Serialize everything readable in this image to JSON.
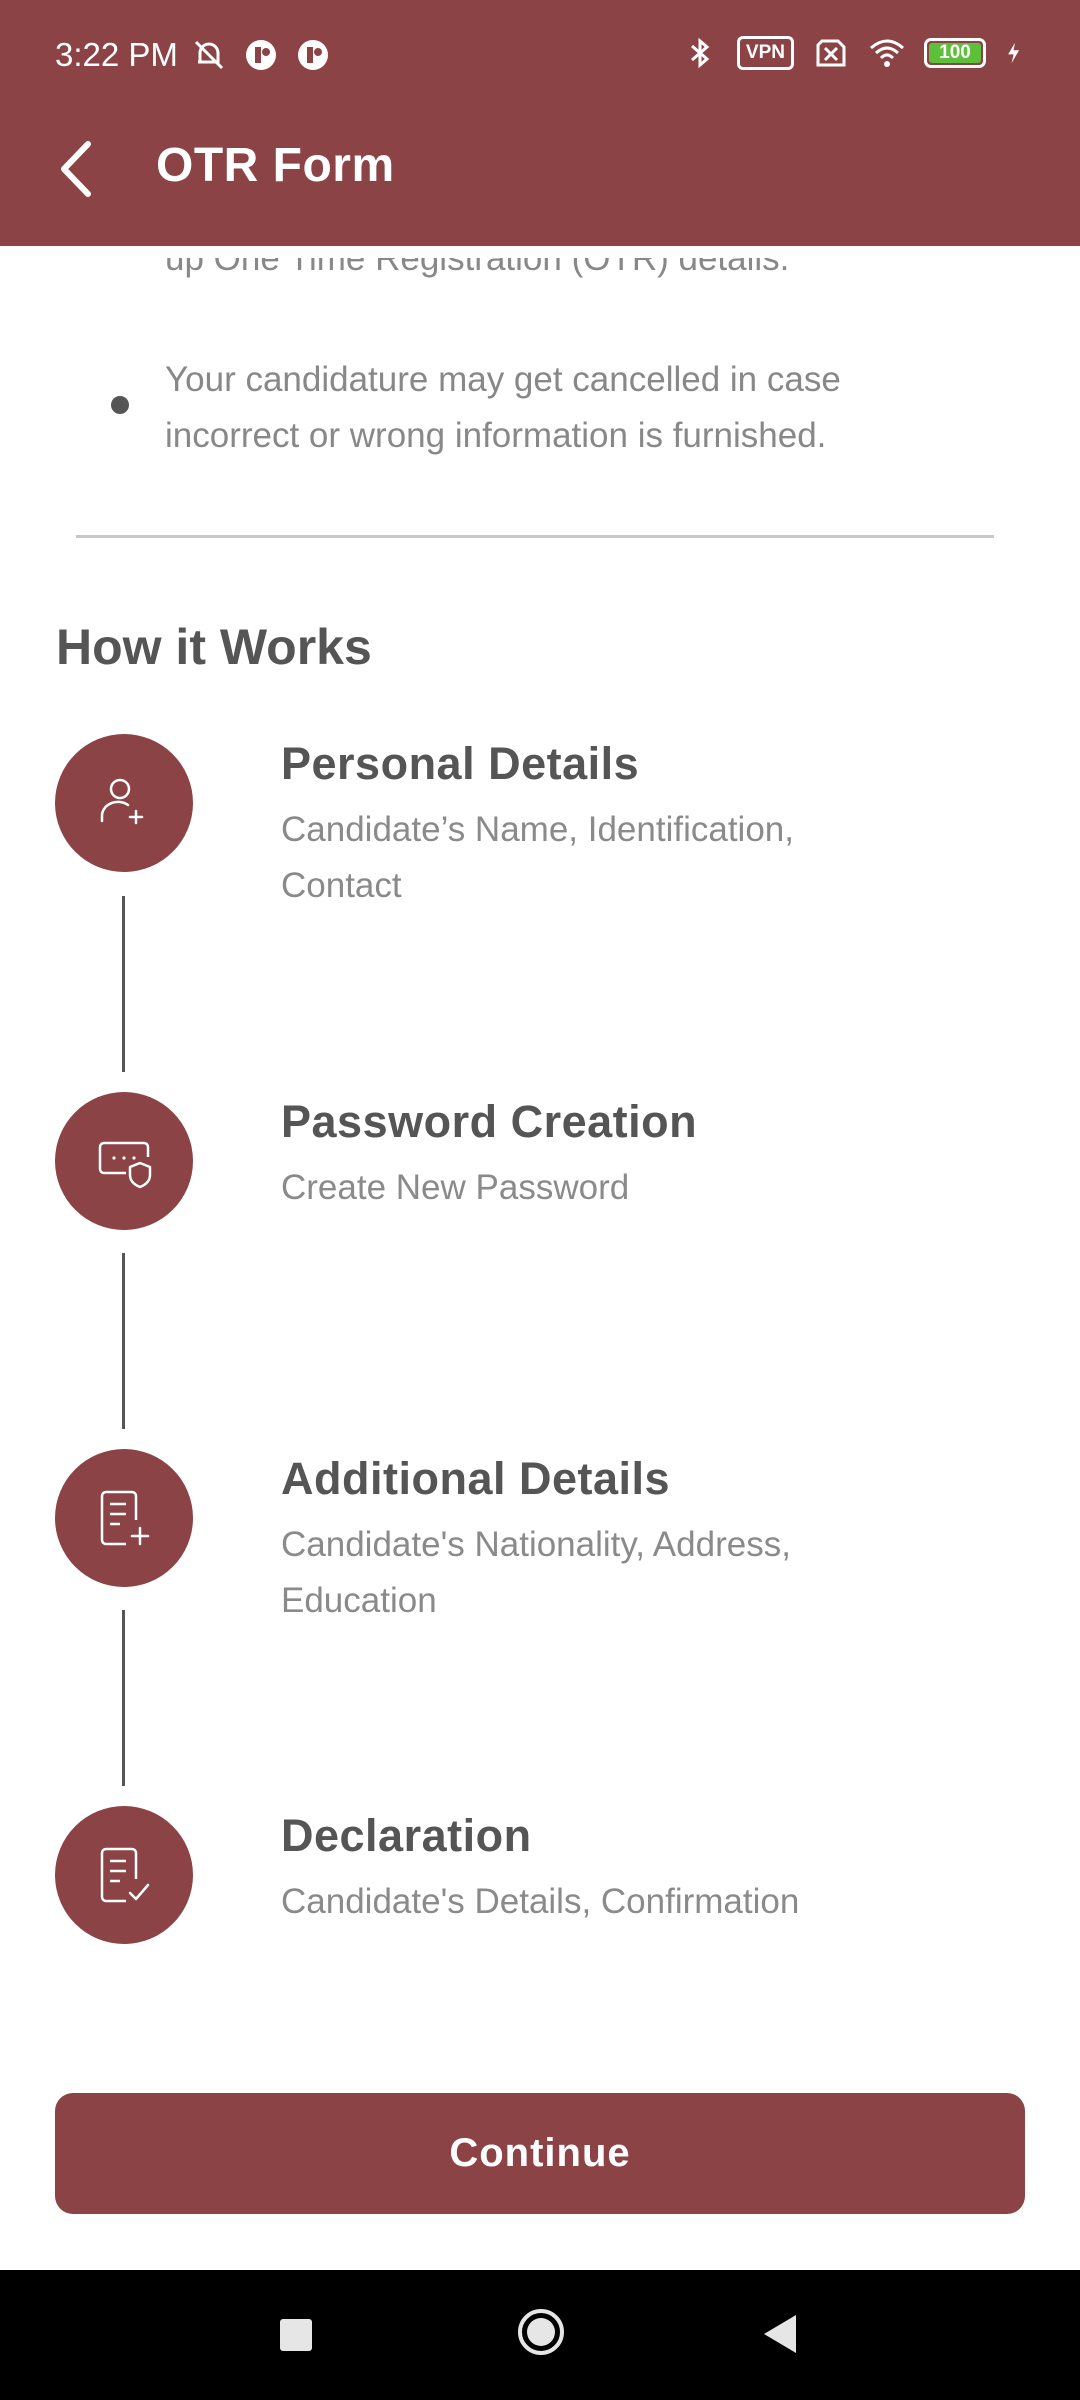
{
  "status_bar": {
    "time": "3:22 PM",
    "vpn": "VPN",
    "battery": "100"
  },
  "app_bar": {
    "title": "OTR Form"
  },
  "notes": {
    "cut_off_line": "up One Time Registration (OTR) details.",
    "bullet": "Your candidature may get cancelled in case incorrect or wrong information is furnished."
  },
  "how_it_works": {
    "title": "How it Works",
    "steps": [
      {
        "title": "Personal Details",
        "desc": "Candidate’s Name, Identification, Contact",
        "icon": "add-user-icon"
      },
      {
        "title": "Password Creation",
        "desc": "Create New Password",
        "icon": "password-shield-icon"
      },
      {
        "title": "Additional Details",
        "desc": "Candidate's Nationality, Address, Education",
        "icon": "document-add-icon"
      },
      {
        "title": "Declaration",
        "desc": "Candidate's Details, Confirmation",
        "icon": "document-check-icon"
      }
    ]
  },
  "continue_label": "Continue",
  "colors": {
    "primary": "#8b4345",
    "text": "#555555",
    "muted": "#8a8a8a"
  }
}
